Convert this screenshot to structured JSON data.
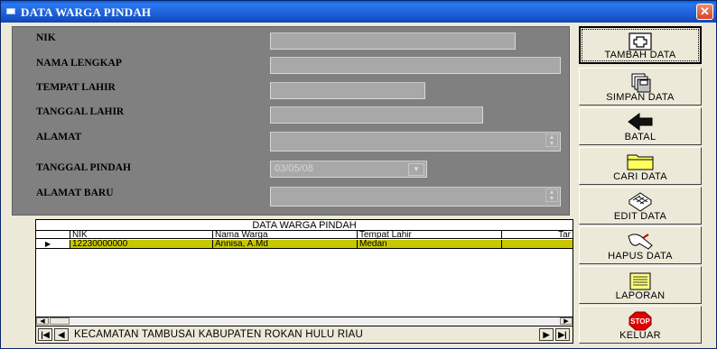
{
  "window": {
    "title": "DATA WARGA PINDAH",
    "close_glyph": "✕"
  },
  "form": {
    "nik_label": "NIK",
    "nama_label": "NAMA LENGKAP",
    "tempat_label": "TEMPAT LAHIR",
    "tanggal_lahir_label": "TANGGAL LAHIR",
    "alamat_label": "ALAMAT",
    "tanggal_pindah_label": "TANGGAL PINDAH",
    "tanggal_pindah_value": "03/05/08",
    "alamat_baru_label": "ALAMAT BARU"
  },
  "grid": {
    "caption": "DATA WARGA PINDAH",
    "columns": [
      "NIK",
      "Nama Warga",
      "Tempat Lahir",
      "Tar"
    ],
    "rows": [
      {
        "nik": "12230000000",
        "nama": "Annisa, A.Md",
        "tempat": "Medan"
      }
    ],
    "navigator_caption": "KECAMATAN TAMBUSAI KABUPATEN ROKAN HULU RIAU"
  },
  "buttons": {
    "tambah": "TAMBAH DATA",
    "simpan": "SIMPAN DATA",
    "batal": "BATAL",
    "cari": "CARI DATA",
    "edit": "EDIT DATA",
    "hapus": "HAPUS DATA",
    "laporan": "LAPORAN",
    "keluar": "KELUAR",
    "stop_text": "STOP"
  }
}
